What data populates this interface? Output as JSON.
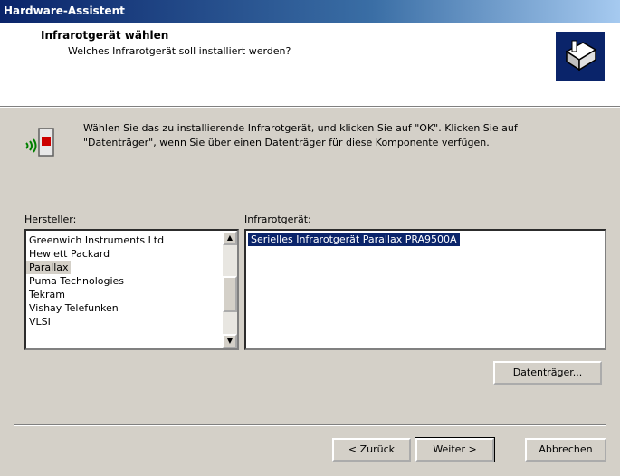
{
  "window": {
    "title": "Hardware-Assistent"
  },
  "header": {
    "title": "Infrarotgerät wählen",
    "subtitle": "Welches Infrarotgerät soll installiert werden?",
    "icon": "hardware-wizard-icon"
  },
  "info": {
    "line1": "Wählen Sie das zu installierende Infrarotgerät, und klicken Sie auf \"OK\". Klicken Sie auf",
    "line2": "\"Datenträger\", wenn Sie über einen Datenträger für diese Komponente verfügen.",
    "icon": "infrared-device-icon"
  },
  "manufacturers": {
    "label": "Hersteller:",
    "items": [
      "Greenwich Instruments Ltd",
      "Hewlett Packard",
      "Parallax",
      "Puma Technologies",
      "Tekram",
      "Vishay Telefunken",
      "VLSI"
    ],
    "selected_index": 2
  },
  "devices": {
    "label": "Infrarotgerät:",
    "items": [
      "Serielles Infrarotgerät Parallax PRA9500A"
    ],
    "selected_index": 0
  },
  "buttons": {
    "disk": "Datenträger...",
    "back": "< Zurück",
    "next": "Weiter >",
    "cancel": "Abbrechen"
  },
  "colors": {
    "titlebar": "#0a246a",
    "selection": "#0a246a",
    "dialog": "#d4d0c8"
  }
}
